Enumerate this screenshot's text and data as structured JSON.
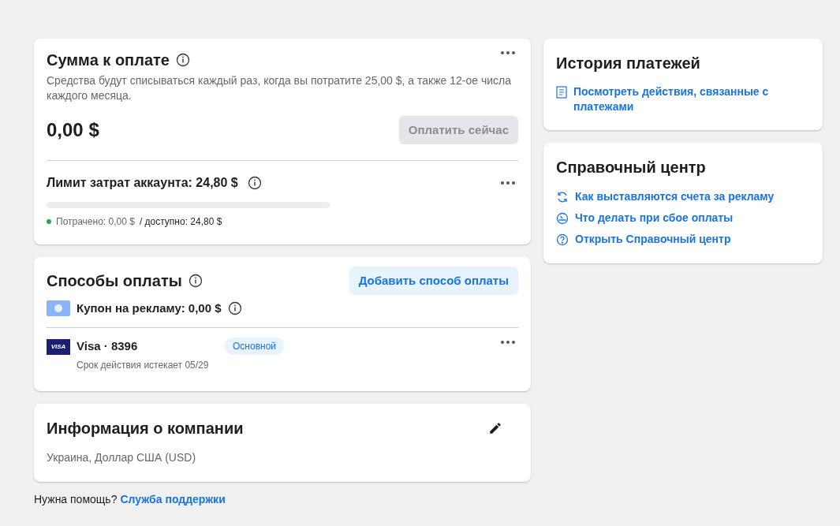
{
  "amount_due": {
    "title": "Сумма к оплате",
    "description": "Средства будут списываться каждый раз, когда вы потратите 25,00 $, а также 12-ое числа каждого месяца.",
    "amount": "0,00 $",
    "pay_button": {
      "label": "Оплатить сейчас",
      "disabled": true
    },
    "limit": {
      "title": "Лимит затрат аккаунта: 24,80 $",
      "level": 0,
      "spent": "Потрачено: 0,00 $",
      "available": "/ доступно: 24,80 $"
    }
  },
  "payment_methods": {
    "title": "Способы оплаты",
    "add_button": "Добавить способ оплаты",
    "coupon": "Купон на рекламу: 0,00 $",
    "cards": [
      {
        "brand": "VISA",
        "name": "Visa · 8396",
        "expiry": "Срок действия истекает 05/29",
        "badge": "Основной"
      }
    ]
  },
  "company_info": {
    "title": "Информация о компании",
    "details": "Украина, Доллар США (USD)"
  },
  "help_footer": {
    "text": "Нужна помощь?",
    "link": "Служба поддержки"
  },
  "payment_history": {
    "title": "История платежей",
    "link": "Посмотреть действия, связанные с платежами"
  },
  "help_center": {
    "title": "Справочный центр",
    "links": [
      {
        "kind": "refresh",
        "label": "Как выставляются счета за рекламу"
      },
      {
        "kind": "gauge",
        "label": "Что делать при сбое оплаты"
      },
      {
        "kind": "question",
        "label": "Открыть Справочный центр"
      }
    ]
  }
}
